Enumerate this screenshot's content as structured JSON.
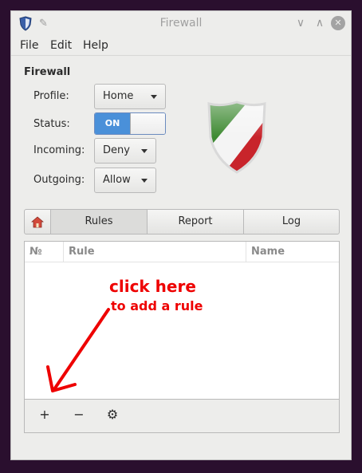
{
  "window": {
    "title": "Firewall",
    "minimize": "∨",
    "maximize": "∧",
    "close": "✕"
  },
  "menu": [
    "File",
    "Edit",
    "Help"
  ],
  "section_title": "Firewall",
  "settings": {
    "profile": {
      "label": "Profile:",
      "value": "Home"
    },
    "status": {
      "label": "Status:",
      "value": "ON",
      "on": true
    },
    "incoming": {
      "label": "Incoming:",
      "value": "Deny"
    },
    "outgoing": {
      "label": "Outgoing:",
      "value": "Allow"
    }
  },
  "tabs": [
    "Rules",
    "Report",
    "Log"
  ],
  "table": {
    "columns": [
      "№",
      "Rule",
      "Name"
    ],
    "rows": []
  },
  "toolbar": {
    "add": "+",
    "remove": "−",
    "settings": "⚙"
  },
  "annotation": {
    "line1": "click here",
    "line2": "to add a rule"
  },
  "colors": {
    "accent": "#4a90d9",
    "annotation": "#ee0000",
    "shield_green": "#3e8a32",
    "shield_red": "#c8242b"
  }
}
